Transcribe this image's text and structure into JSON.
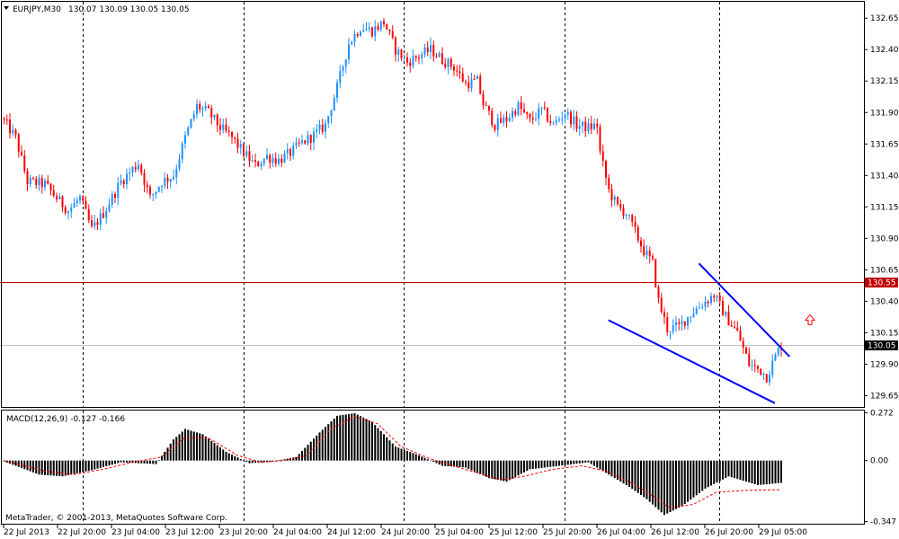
{
  "header": {
    "symbol": "EURJPY,M30",
    "ohlc": "130.07 130.09 130.05 130.05"
  },
  "colors": {
    "bull": "#1e90ff",
    "bear": "#ff0000",
    "sr_line": "#c00000",
    "channel": "#0000ff",
    "arrow": "#ff0000",
    "bid_line": "#c0c0c0",
    "macd_signal": "#ff0000",
    "macd_hist": "#000000",
    "frame": "#000000",
    "bg": "#ffffff"
  },
  "chart_data": [
    {
      "type": "candlestick",
      "symbol": "EURJPY",
      "timeframe": "M30",
      "ylim": [
        129.56,
        132.78
      ],
      "y_ticks": [
        "132.65",
        "132.40",
        "132.15",
        "131.90",
        "131.65",
        "131.40",
        "131.15",
        "130.90",
        "130.65",
        "130.40",
        "130.15",
        "129.90",
        "129.65"
      ],
      "x_labels": [
        "22 Jul 2013",
        "22 Jul 20:00",
        "23 Jul 04:00",
        "23 Jul 12:00",
        "23 Jul 20:00",
        "24 Jul 04:00",
        "24 Jul 12:00",
        "24 Jul 20:00",
        "25 Jul 04:00",
        "25 Jul 12:00",
        "25 Jul 20:00",
        "26 Jul 04:00",
        "26 Jul 12:00",
        "26 Jul 20:00",
        "29 Jul 05:00"
      ],
      "session_separators": [
        "22 Jul 20:00",
        "23 Jul 20:00",
        "24 Jul 20:00",
        "25 Jul 20:00",
        "26 Jul 20:00"
      ],
      "close_path": [
        [
          0,
          131.83
        ],
        [
          4,
          131.7
        ],
        [
          8,
          131.35
        ],
        [
          14,
          131.33
        ],
        [
          18,
          131.22
        ],
        [
          22,
          131.12
        ],
        [
          26,
          131.22
        ],
        [
          30,
          130.97
        ],
        [
          34,
          131.1
        ],
        [
          40,
          131.35
        ],
        [
          46,
          131.5
        ],
        [
          50,
          131.22
        ],
        [
          54,
          131.35
        ],
        [
          58,
          131.4
        ],
        [
          62,
          131.7
        ],
        [
          66,
          131.95
        ],
        [
          70,
          131.9
        ],
        [
          74,
          131.78
        ],
        [
          78,
          131.7
        ],
        [
          82,
          131.58
        ],
        [
          86,
          131.48
        ],
        [
          90,
          131.55
        ],
        [
          94,
          131.52
        ],
        [
          98,
          131.58
        ],
        [
          102,
          131.66
        ],
        [
          106,
          131.72
        ],
        [
          110,
          131.8
        ],
        [
          114,
          132.1
        ],
        [
          118,
          132.45
        ],
        [
          122,
          132.58
        ],
        [
          126,
          132.55
        ],
        [
          130,
          132.62
        ],
        [
          134,
          132.4
        ],
        [
          138,
          132.3
        ],
        [
          142,
          132.35
        ],
        [
          146,
          132.4
        ],
        [
          150,
          132.32
        ],
        [
          154,
          132.26
        ],
        [
          158,
          132.13
        ],
        [
          162,
          132.15
        ],
        [
          164,
          131.97
        ],
        [
          168,
          131.8
        ],
        [
          172,
          131.85
        ],
        [
          176,
          131.95
        ],
        [
          180,
          131.83
        ],
        [
          184,
          131.92
        ],
        [
          188,
          131.8
        ],
        [
          192,
          131.9
        ],
        [
          196,
          131.8
        ],
        [
          200,
          131.78
        ],
        [
          203,
          131.8
        ],
        [
          204,
          131.58
        ],
        [
          207,
          131.28
        ],
        [
          210,
          131.15
        ],
        [
          213,
          131.1
        ],
        [
          216,
          130.95
        ],
        [
          219,
          130.8
        ],
        [
          222,
          130.7
        ],
        [
          224,
          130.4
        ],
        [
          227,
          130.18
        ],
        [
          231,
          130.2
        ],
        [
          235,
          130.3
        ],
        [
          239,
          130.38
        ],
        [
          243,
          130.45
        ],
        [
          247,
          130.28
        ],
        [
          251,
          130.15
        ],
        [
          255,
          129.9
        ],
        [
          259,
          129.85
        ],
        [
          261,
          129.8
        ],
        [
          264,
          129.96
        ],
        [
          266,
          130.05
        ]
      ],
      "candles_count": 267,
      "price_levels": [
        {
          "label": "130.55",
          "value": 130.55,
          "kind": "horizontal-line"
        },
        {
          "label": "130.05",
          "value": 130.05,
          "kind": "bid"
        }
      ],
      "trendlines": [
        {
          "name": "channel-top",
          "from": [
            238,
            130.7
          ],
          "to": [
            269,
            129.96
          ]
        },
        {
          "name": "channel-bottom",
          "from": [
            207,
            130.25
          ],
          "to": [
            264,
            129.59
          ]
        }
      ],
      "arrow": {
        "index": 276,
        "value": 130.25,
        "direction": "up"
      }
    },
    {
      "type": "histogram",
      "indicator": "MACD",
      "label": "MACD(12,26,9) -0.127 -0.166",
      "ylim": [
        -0.36,
        0.285
      ],
      "y_ticks": [
        "0.272",
        "0.00",
        "-0.347"
      ],
      "main_path": [
        [
          0,
          -0.005
        ],
        [
          12,
          -0.08
        ],
        [
          20,
          -0.09
        ],
        [
          30,
          -0.055
        ],
        [
          40,
          -0.01
        ],
        [
          52,
          -0.02
        ],
        [
          58,
          0.12
        ],
        [
          62,
          0.18
        ],
        [
          68,
          0.15
        ],
        [
          76,
          0.05
        ],
        [
          84,
          -0.015
        ],
        [
          92,
          -0.005
        ],
        [
          100,
          0.02
        ],
        [
          108,
          0.16
        ],
        [
          114,
          0.255
        ],
        [
          120,
          0.27
        ],
        [
          126,
          0.22
        ],
        [
          134,
          0.08
        ],
        [
          142,
          0.03
        ],
        [
          150,
          -0.03
        ],
        [
          158,
          -0.04
        ],
        [
          166,
          -0.1
        ],
        [
          172,
          -0.12
        ],
        [
          180,
          -0.05
        ],
        [
          190,
          -0.03
        ],
        [
          200,
          -0.01
        ],
        [
          208,
          -0.09
        ],
        [
          214,
          -0.15
        ],
        [
          220,
          -0.22
        ],
        [
          226,
          -0.31
        ],
        [
          232,
          -0.26
        ],
        [
          240,
          -0.16
        ],
        [
          248,
          -0.09
        ],
        [
          258,
          -0.14
        ],
        [
          266,
          -0.127
        ]
      ],
      "signal_path": [
        [
          0,
          0.0
        ],
        [
          14,
          -0.06
        ],
        [
          24,
          -0.08
        ],
        [
          34,
          -0.05
        ],
        [
          44,
          -0.01
        ],
        [
          54,
          0.02
        ],
        [
          62,
          0.13
        ],
        [
          70,
          0.13
        ],
        [
          80,
          0.03
        ],
        [
          88,
          -0.01
        ],
        [
          96,
          0.0
        ],
        [
          104,
          0.03
        ],
        [
          112,
          0.18
        ],
        [
          120,
          0.25
        ],
        [
          128,
          0.21
        ],
        [
          136,
          0.08
        ],
        [
          146,
          0.01
        ],
        [
          154,
          -0.03
        ],
        [
          162,
          -0.07
        ],
        [
          170,
          -0.11
        ],
        [
          178,
          -0.09
        ],
        [
          188,
          -0.05
        ],
        [
          198,
          -0.03
        ],
        [
          206,
          -0.06
        ],
        [
          214,
          -0.12
        ],
        [
          222,
          -0.2
        ],
        [
          228,
          -0.27
        ],
        [
          236,
          -0.25
        ],
        [
          244,
          -0.18
        ],
        [
          254,
          -0.17
        ],
        [
          266,
          -0.166
        ]
      ]
    }
  ],
  "copyright": "MetaTrader, © 2001-2013, MetaQuotes Software Corp."
}
